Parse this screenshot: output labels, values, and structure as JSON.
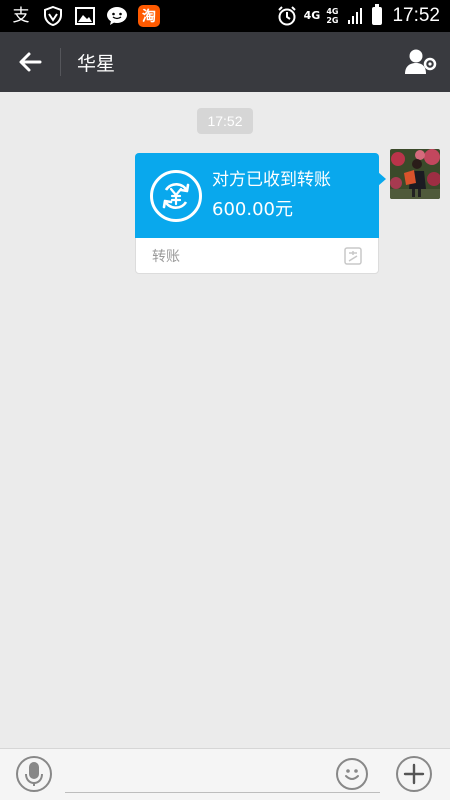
{
  "status_bar": {
    "icons": [
      "alipay-icon",
      "shield-icon",
      "gallery-icon",
      "chat-icon",
      "taobao-icon",
      "alarm-icon",
      "signal-icon",
      "battery-icon"
    ],
    "alipay_glyph": "支",
    "taobao_glyph": "淘",
    "net1": "4G",
    "net2a": "4G",
    "net2b": "2G",
    "time": "17:52"
  },
  "header": {
    "title": "华星"
  },
  "chat": {
    "timestamp": "17:52",
    "transfer": {
      "title": "对方已收到转账",
      "amount": "600.00元",
      "label": "转账"
    }
  },
  "input": {
    "value": "",
    "placeholder": ""
  },
  "colors": {
    "header_bg": "#393a3f",
    "transfer_blue": "#09a8ed",
    "chat_bg": "#ebebeb"
  }
}
